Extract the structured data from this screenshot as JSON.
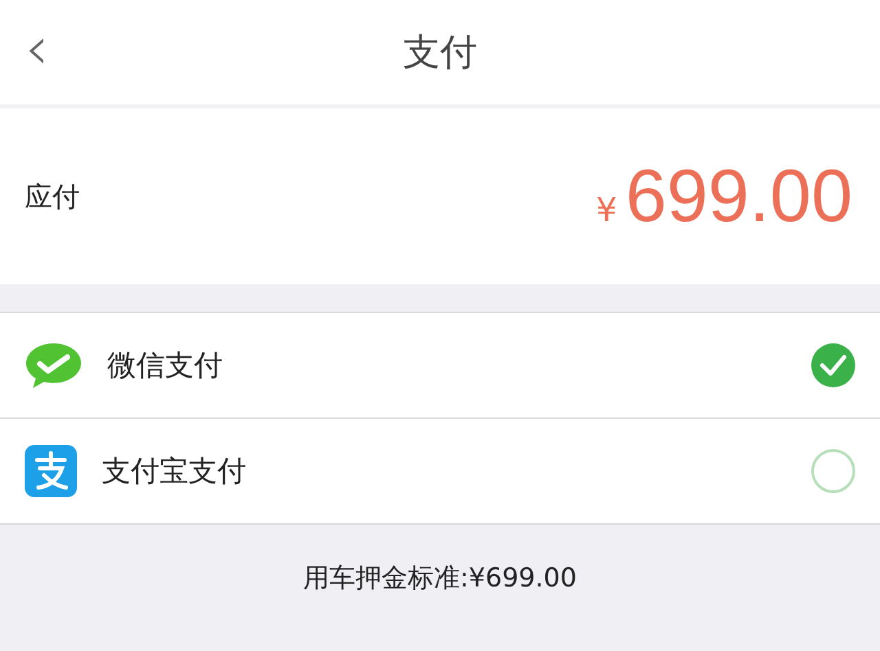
{
  "nav": {
    "back_icon": "‹",
    "title": "支付"
  },
  "amount": {
    "label": "应付",
    "currency_symbol": "¥",
    "value": "699.00"
  },
  "payment_methods": [
    {
      "kind": "wechat",
      "label": "微信支付",
      "selected": true
    },
    {
      "kind": "alipay",
      "label": "支付宝支付",
      "selected": false
    }
  ],
  "footer_note": "用车押金标准:¥699.00"
}
